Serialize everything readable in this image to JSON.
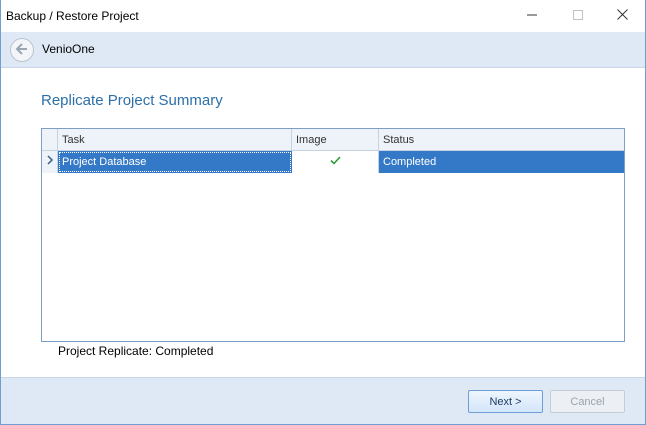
{
  "window": {
    "title": "Backup / Restore Project",
    "controls": {
      "minimize_icon": "minimize-icon",
      "maximize_icon": "maximize-icon",
      "close_icon": "close-icon"
    }
  },
  "navbar": {
    "back_icon": "back-arrow-icon",
    "title": "VenioOne"
  },
  "main": {
    "heading": "Replicate Project Summary",
    "grid": {
      "columns": [
        "Task",
        "Image",
        "Status"
      ],
      "rows": [
        {
          "task": "Project Database",
          "image": "check-icon",
          "status": "Completed",
          "selected": true
        }
      ]
    },
    "summary": "Project Replicate: Completed"
  },
  "footer": {
    "next_label": "Next >",
    "cancel_label": "Cancel"
  },
  "colors": {
    "accent": "#2d6fa8",
    "selection": "#3479c7",
    "panel": "#dfe9f5",
    "check": "#2e9e3c"
  }
}
